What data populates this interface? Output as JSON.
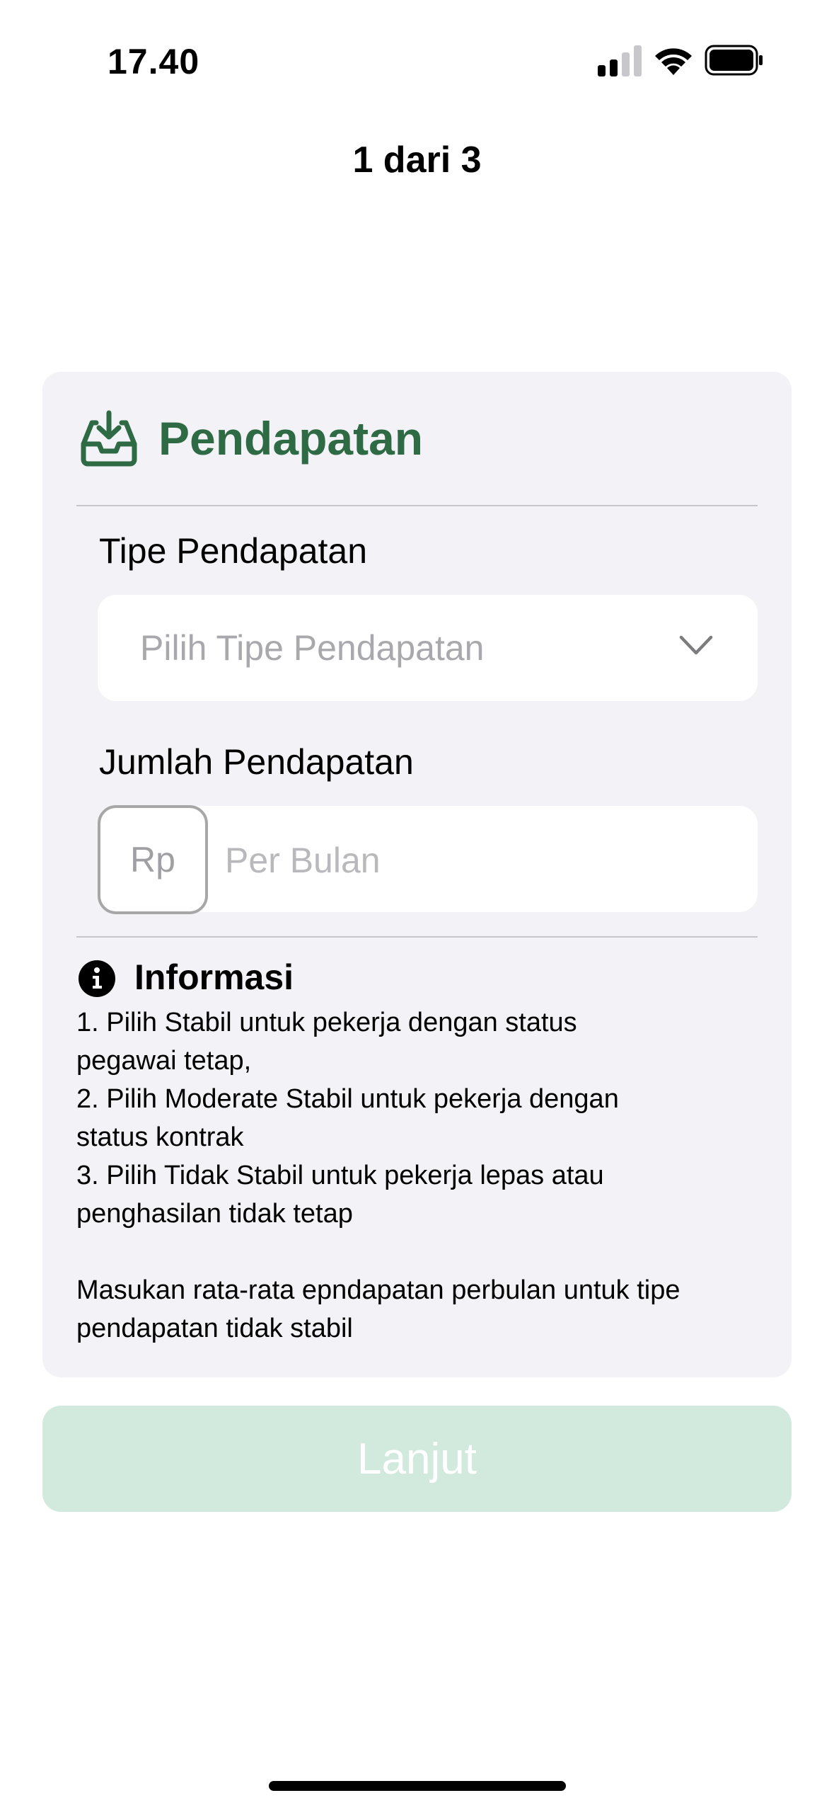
{
  "status_bar": {
    "time": "17.40",
    "signal_icon": "cellular-signal-icon",
    "wifi_icon": "wifi-icon",
    "battery_icon": "battery-icon"
  },
  "header": {
    "step_title": "1 dari 3"
  },
  "section": {
    "icon": "inbox-download-icon",
    "title": "Pendapatan",
    "accent_color": "#2e6b45"
  },
  "income_type": {
    "label": "Tipe Pendapatan",
    "placeholder": "Pilih Tipe Pendapatan"
  },
  "income_amount": {
    "label": "Jumlah Pendapatan",
    "currency": "Rp",
    "placeholder": "Per Bulan"
  },
  "info": {
    "icon": "info-circle-icon",
    "title": "Informasi",
    "lines": [
      "1. Pilih Stabil untuk pekerja dengan status",
      "pegawai tetap,",
      "2. Pilih Moderate Stabil untuk pekerja dengan",
      "status kontrak",
      "3. Pilih Tidak Stabil untuk pekerja lepas atau",
      "penghasilan tidak tetap"
    ],
    "note_lines": [
      "Masukan rata-rata epndapatan perbulan untuk tipe",
      "pendapatan tidak stabil"
    ]
  },
  "actions": {
    "continue_label": "Lanjut",
    "continue_color": "#d2e9dd"
  }
}
